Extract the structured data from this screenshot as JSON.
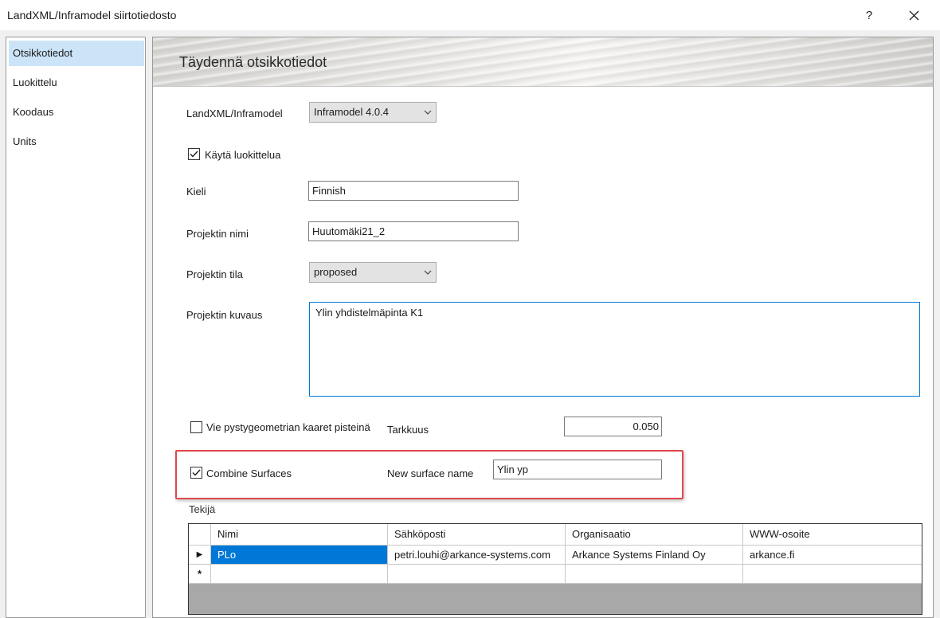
{
  "window": {
    "title": "LandXML/Inframodel siirtotiedosto",
    "help_label": "?"
  },
  "sidebar": {
    "items": [
      {
        "label": "Otsikkotiedot"
      },
      {
        "label": "Luokittelu"
      },
      {
        "label": "Koodaus"
      },
      {
        "label": "Units"
      }
    ],
    "selected": "Otsikkotiedot"
  },
  "header": {
    "title": "Täydennä otsikkotiedot"
  },
  "form": {
    "landxml": {
      "label": "LandXML/Inframodel",
      "value": "Inframodel 4.0.4"
    },
    "use_classification": {
      "label": "Käytä luokittelua",
      "checked": true
    },
    "language": {
      "label": "Kieli",
      "value": "Finnish"
    },
    "project_name": {
      "label": "Projektin nimi",
      "value": "Huutomäki21_2"
    },
    "project_state": {
      "label": "Projektin tila",
      "value": "proposed"
    },
    "project_description": {
      "label": "Projektin kuvaus",
      "value": "Ylin yhdistelmäpinta K1"
    },
    "vertical_arcs": {
      "label": "Vie pystygeometrian kaaret pisteinä",
      "checked": false
    },
    "precision": {
      "label": "Tarkkuus",
      "value": "0.050"
    },
    "combine_surfaces": {
      "label": "Combine Surfaces",
      "checked": true
    },
    "new_surface_name": {
      "label": "New surface name",
      "value": "Ylin yp"
    },
    "author_label": "Tekijä"
  },
  "author_grid": {
    "columns": [
      "Nimi",
      "Sähköposti",
      "Organisaatio",
      "WWW-osoite"
    ],
    "rows": [
      {
        "marker": "▶",
        "cells": [
          "PLo",
          "petri.louhi@arkance-systems.com",
          "Arkance Systems Finland Oy",
          "arkance.fi"
        ]
      }
    ],
    "new_row_marker": "*"
  },
  "colors": {
    "selection": "#0078d7",
    "highlight_box": "#e0474c",
    "sidebar_selected": "#cce4f7"
  }
}
